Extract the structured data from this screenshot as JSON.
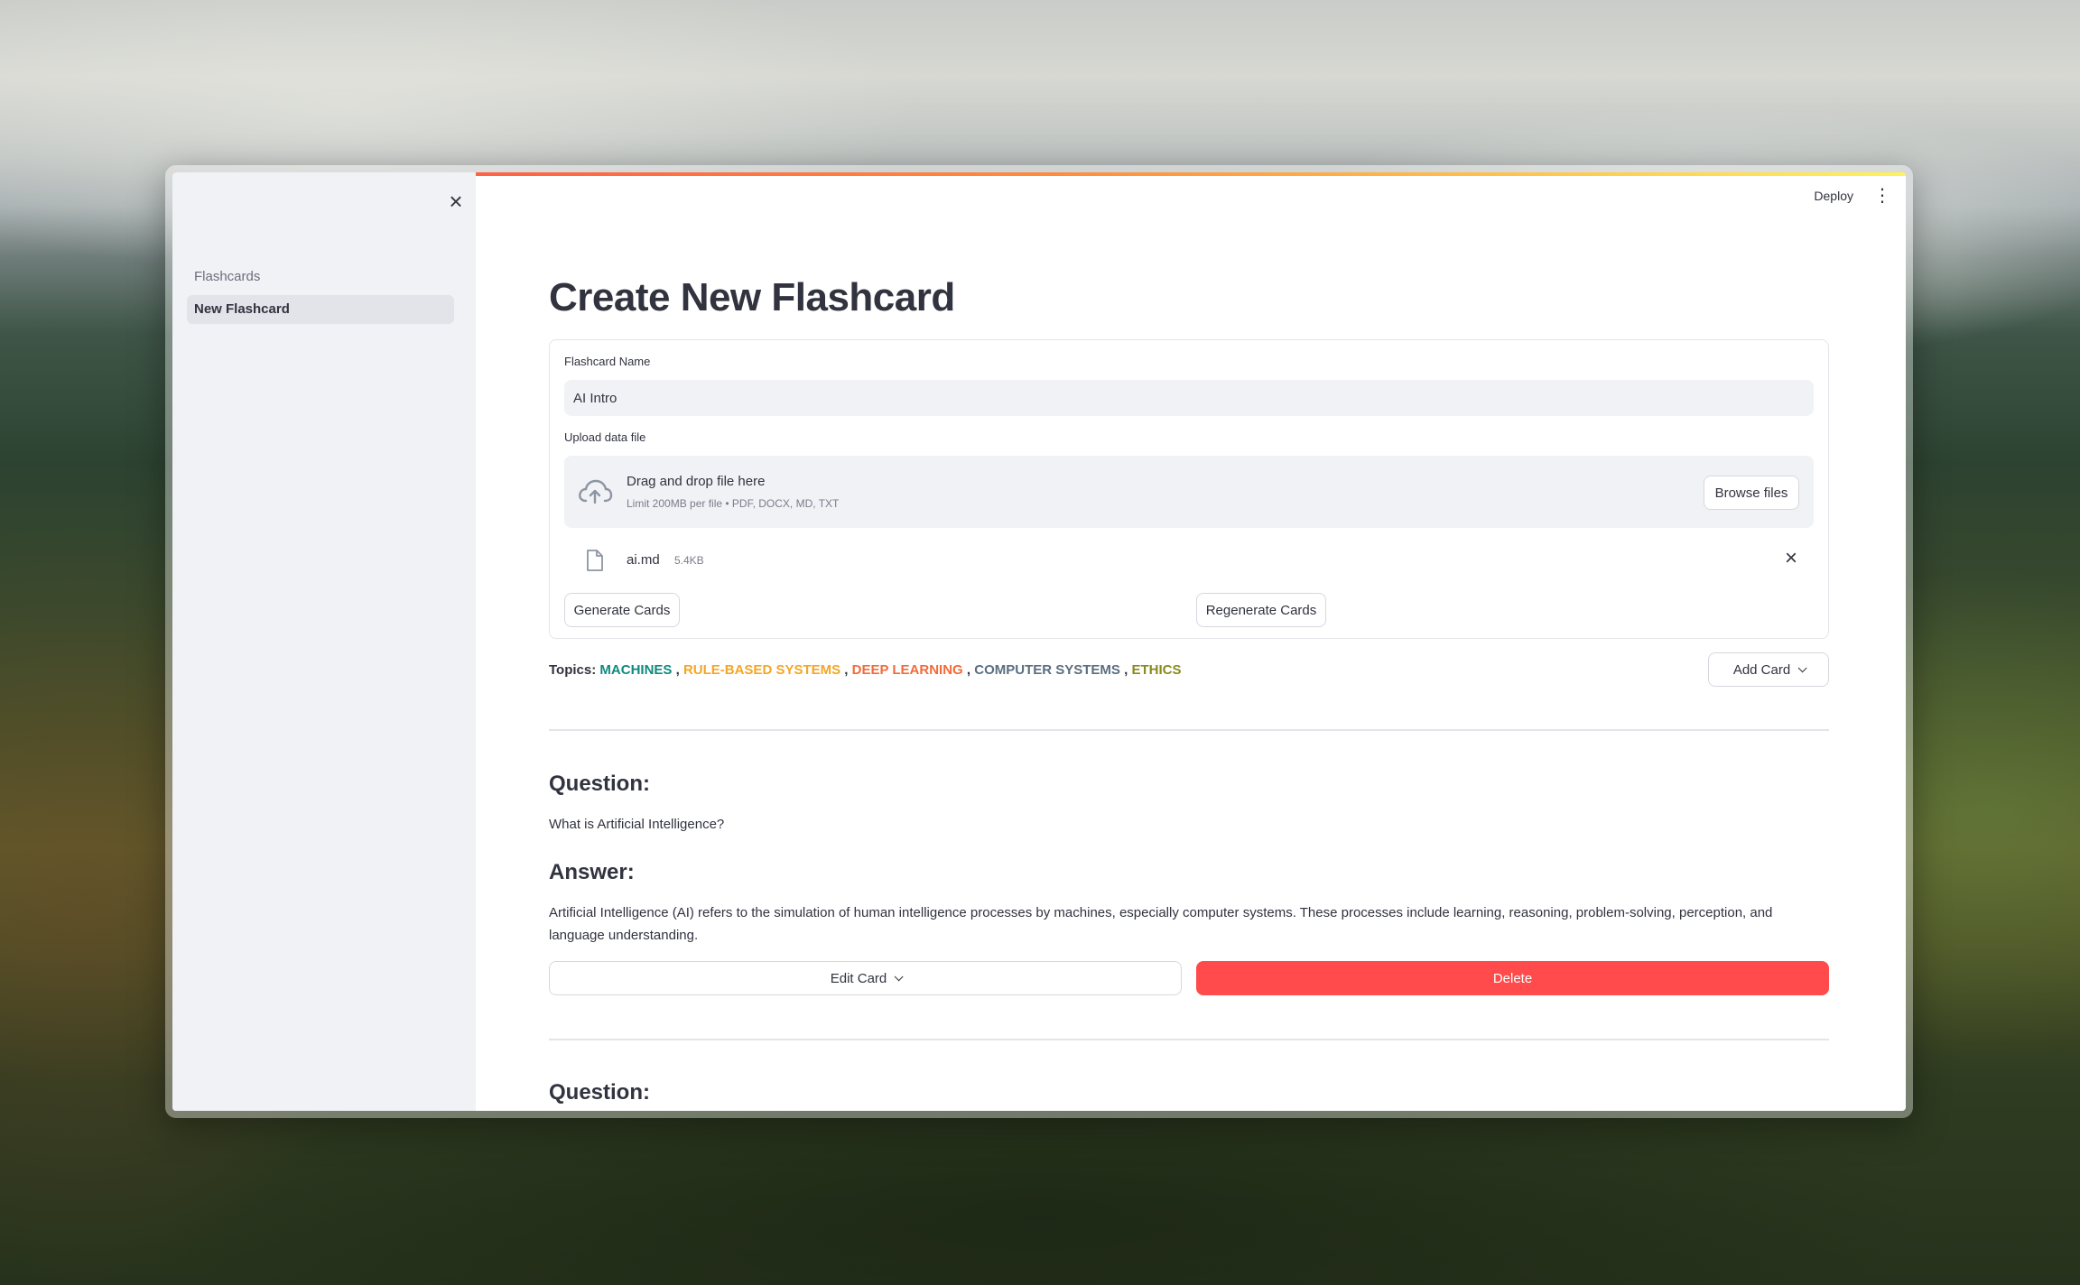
{
  "sidebar": {
    "nav": [
      {
        "label": "Flashcards",
        "active": false
      },
      {
        "label": "New Flashcard",
        "active": true
      }
    ]
  },
  "header": {
    "deploy_label": "Deploy"
  },
  "main": {
    "title": "Create New Flashcard",
    "form": {
      "name_label": "Flashcard Name",
      "name_value": "AI Intro",
      "upload_label": "Upload data file",
      "dropzone_title": "Drag and drop file here",
      "dropzone_limit": "Limit 200MB per file • PDF, DOCX, MD, TXT",
      "browse_label": "Browse files",
      "file": {
        "name": "ai.md",
        "size": "5.4KB"
      },
      "generate_label": "Generate Cards",
      "regenerate_label": "Regenerate Cards"
    },
    "topics": {
      "label": "Topics:",
      "items": [
        {
          "text": "MACHINES",
          "color": "#0e8a7e"
        },
        {
          "text": "RULE-BASED SYSTEMS",
          "color": "#f5a623"
        },
        {
          "text": "DEEP LEARNING",
          "color": "#f26b3a"
        },
        {
          "text": "COMPUTER SYSTEMS",
          "color": "#5a6e80"
        },
        {
          "text": "ETHICS",
          "color": "#8a8a1e"
        }
      ],
      "separator": ","
    },
    "add_card_label": "Add Card",
    "cards": [
      {
        "question_heading": "Question:",
        "question": "What is Artificial Intelligence?",
        "answer_heading": "Answer:",
        "answer": "Artificial Intelligence (AI) refers to the simulation of human intelligence processes by machines, especially computer systems. These processes include learning, reasoning, problem-solving, perception, and language understanding.",
        "edit_label": "Edit Card",
        "delete_label": "Delete"
      },
      {
        "question_heading": "Question:"
      }
    ]
  },
  "colors": {
    "accent": "#ff4b4b",
    "sidebar_bg": "#f0f2f6",
    "text": "#31333f"
  }
}
